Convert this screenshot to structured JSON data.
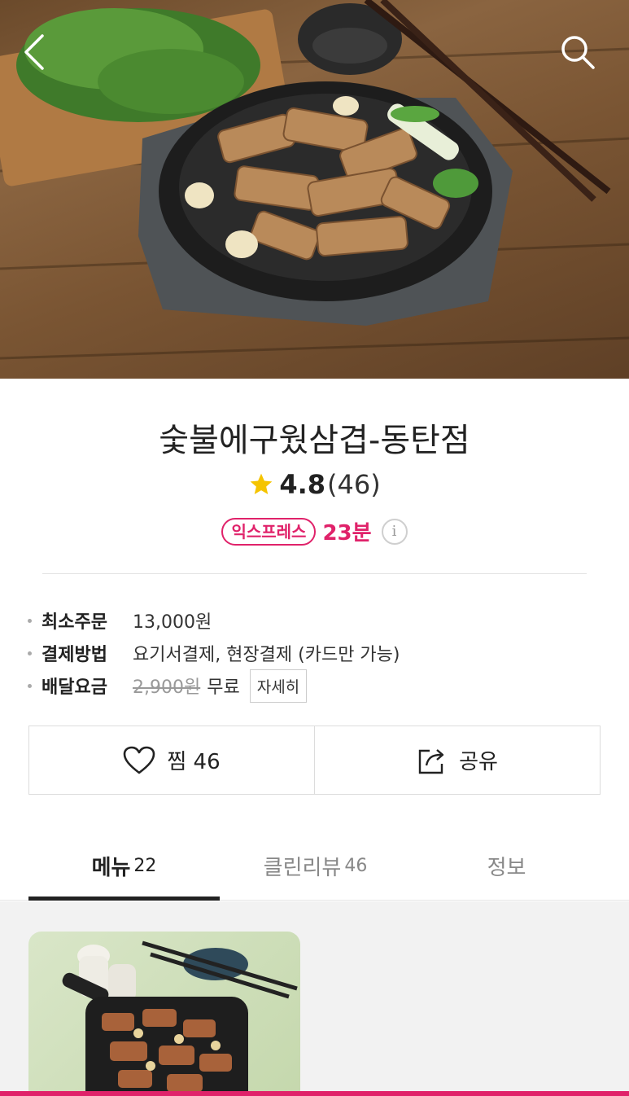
{
  "header": {
    "back_icon": "chevron-left-icon",
    "search_icon": "search-icon"
  },
  "store": {
    "name": "숯불에구웠삼겹-동탄점",
    "rating": "4.8",
    "review_count": "(46)",
    "express_label": "익스프레스",
    "delivery_time": "23분",
    "info_icon": "i"
  },
  "details": [
    {
      "label": "최소주문",
      "value": "13,000원"
    },
    {
      "label": "결제방법",
      "value": "요기서결제, 현장결제 (카드만 가능)"
    },
    {
      "label": "배달요금",
      "original": "2,900원",
      "value": "무료",
      "button": "자세히"
    }
  ],
  "actions": {
    "favorite_label": "찜 46",
    "share_label": "공유"
  },
  "tabs": [
    {
      "label": "메뉴",
      "count": "22",
      "active": true
    },
    {
      "label": "클린리뷰",
      "count": "46",
      "active": false
    },
    {
      "label": "정보",
      "count": "",
      "active": false
    }
  ],
  "colors": {
    "accent": "#e0226a",
    "star": "#f5c400",
    "text": "#222222"
  }
}
